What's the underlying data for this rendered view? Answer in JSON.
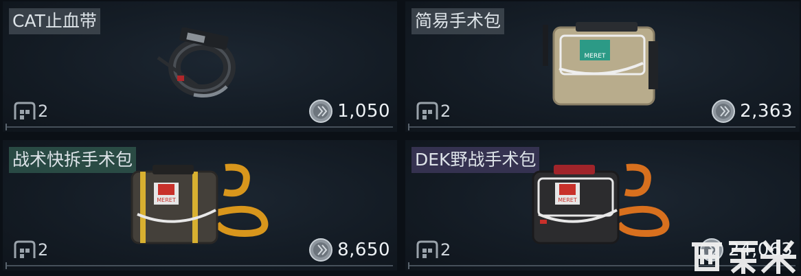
{
  "items": [
    {
      "name": "CAT止血带",
      "slot_size": "2",
      "price": "1,050",
      "tag_color": "#404850"
    },
    {
      "name": "简易手术包",
      "slot_size": "2",
      "price": "2,363",
      "tag_color": "#404850"
    },
    {
      "name": "战术快拆手术包",
      "slot_size": "2",
      "price": "8,650",
      "tag_color": "#2e544a"
    },
    {
      "name": "DEK野战手术包",
      "slot_size": "2",
      "price": "24,063",
      "tag_color": "#3a3656"
    }
  ],
  "icons": {
    "slot": "grid-slot-icon",
    "currency": "coin-icon"
  },
  "bag_label": "MERET",
  "watermark": "酷玩米"
}
